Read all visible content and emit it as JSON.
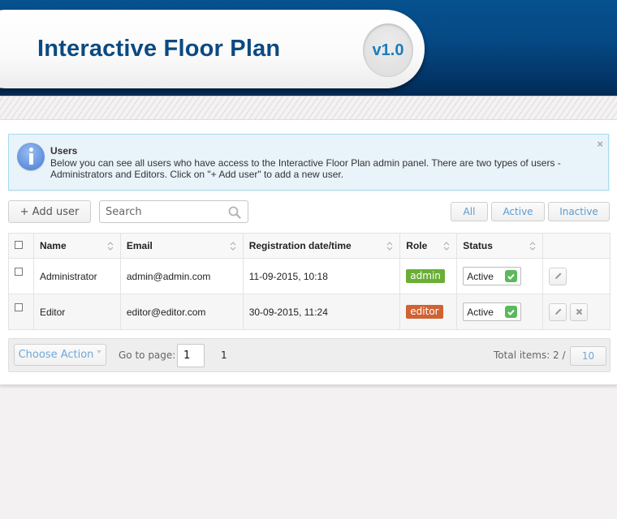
{
  "header": {
    "title": "Interactive Floor Plan",
    "version": "v1.0"
  },
  "alert": {
    "title": "Users",
    "text": "Below you can see all users who have access to the Interactive Floor Plan admin panel. There are two types of users - Administrators and Editors. Click on \"+ Add user\" to add a new user.",
    "close_icon": "×",
    "icon": "info-icon"
  },
  "toolbar": {
    "add_user_label": "+ Add user",
    "search_placeholder": "Search",
    "search_value": "",
    "filters": [
      "All",
      "Active",
      "Inactive"
    ]
  },
  "table": {
    "columns": [
      "Name",
      "Email",
      "Registration date/time",
      "Role",
      "Status"
    ],
    "rows": [
      {
        "name": "Administrator",
        "email": "admin@admin.com",
        "registered": "11-09-2015, 10:18",
        "role": "admin",
        "role_color": "#6aaf35",
        "status": "Active",
        "actions": [
          "edit"
        ]
      },
      {
        "name": "Editor",
        "email": "editor@editor.com",
        "registered": "30-09-2015, 11:24",
        "role": "editor",
        "role_color": "#cf6334",
        "status": "Active",
        "actions": [
          "edit",
          "delete"
        ]
      }
    ]
  },
  "footer": {
    "choose_action_label": "Choose Action",
    "goto_label": "Go to page:",
    "goto_value": "1",
    "page_count": "1",
    "total_label": "Total items: 2 /",
    "per_page": "10"
  },
  "colors": {
    "header_blue": "#054a85",
    "title_blue": "#0b4a82",
    "accent_blue": "#1a7dbd",
    "link_blue": "#5a9bd0",
    "status_green": "#5cb85c"
  }
}
